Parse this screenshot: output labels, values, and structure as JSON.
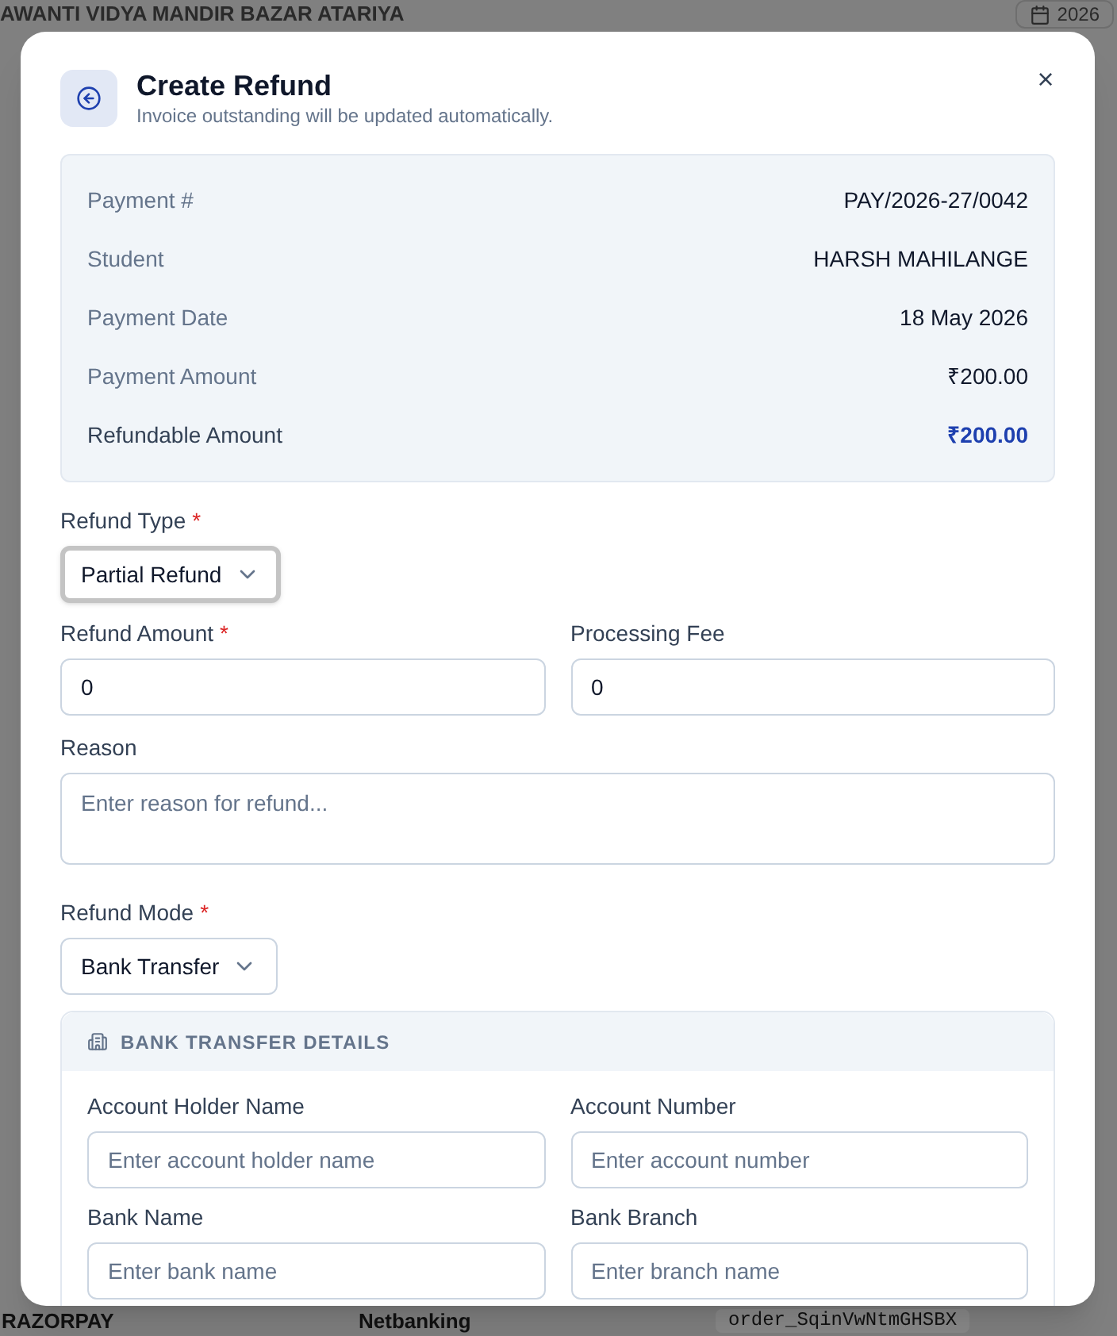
{
  "background": {
    "school_name": "AWANTI VIDYA MANDIR BAZAR ATARIYA",
    "date_chip": "2026",
    "row": {
      "gateway": "RAZORPAY",
      "method": "Netbanking",
      "order_id": "order_SqinVwNtmGHSBX"
    }
  },
  "dialog": {
    "title": "Create Refund",
    "subtitle": "Invoice outstanding will be updated automatically.",
    "close": "×",
    "summary": [
      {
        "label": "Payment #",
        "value": "PAY/2026-27/0042",
        "highlight": false
      },
      {
        "label": "Student",
        "value": "HARSH MAHILANGE",
        "highlight": false
      },
      {
        "label": "Payment Date",
        "value": "18 May 2026",
        "highlight": false
      },
      {
        "label": "Payment Amount",
        "value": "₹200.00",
        "highlight": false
      },
      {
        "label": "Refundable Amount",
        "value": "₹200.00",
        "highlight": true
      }
    ],
    "refund_type": {
      "label": "Refund Type",
      "required_mark": "*",
      "value": "Partial Refund",
      "focused": true
    },
    "amount_fields": [
      {
        "label": "Refund Amount",
        "required_mark": "*",
        "value": "0"
      },
      {
        "label": "Processing Fee",
        "value": "0"
      }
    ],
    "reason": {
      "label": "Reason",
      "placeholder": "Enter reason for refund..."
    },
    "refund_mode": {
      "label": "Refund Mode",
      "required_mark": "*",
      "value": "Bank Transfer",
      "focused": false
    },
    "bank_details": {
      "title": "BANK TRANSFER DETAILS",
      "fields": [
        {
          "label": "Account Holder Name",
          "placeholder": "Enter account holder name"
        },
        {
          "label": "Account Number",
          "placeholder": "Enter account number"
        },
        {
          "label": "Bank Name",
          "placeholder": "Enter bank name"
        },
        {
          "label": "Bank Branch",
          "placeholder": "Enter branch name"
        }
      ]
    }
  }
}
